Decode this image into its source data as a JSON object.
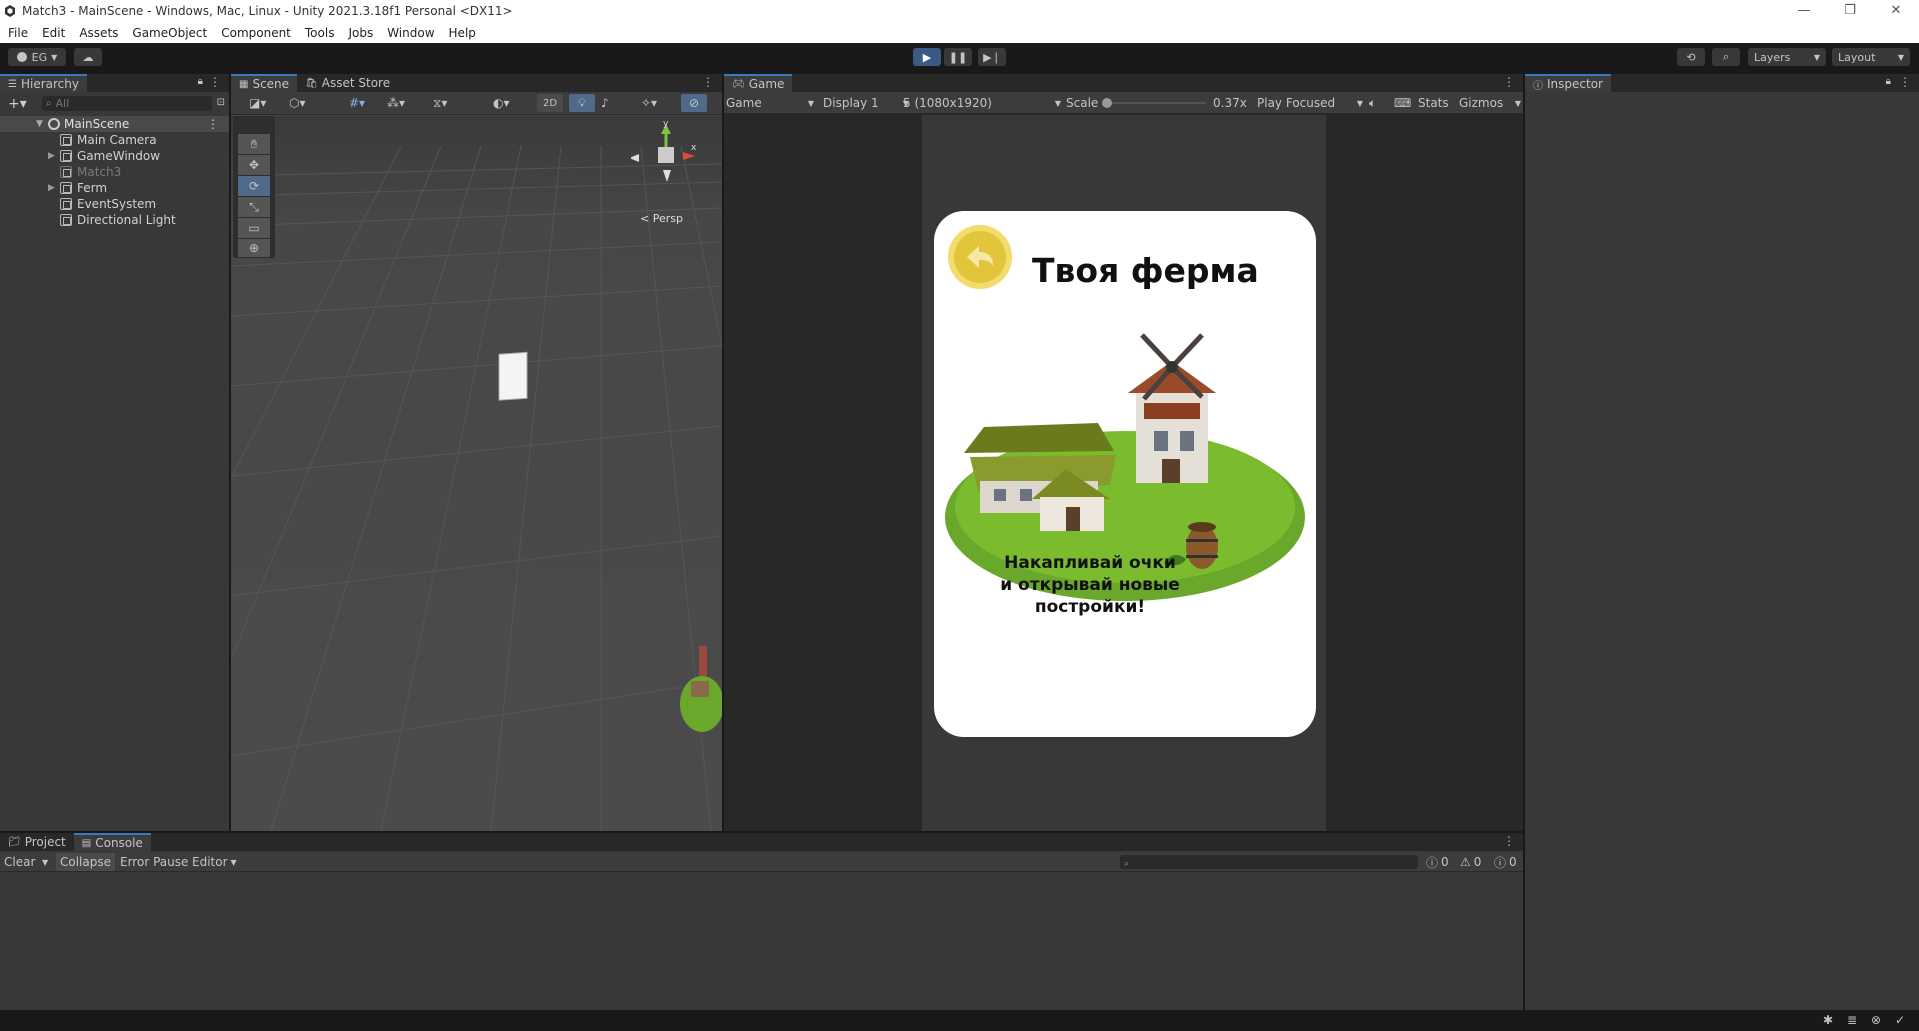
{
  "window": {
    "title": "Match3 - MainScene - Windows, Mac, Linux - Unity 2021.3.18f1 Personal <DX11>",
    "minimize": "—",
    "maximize": "❐",
    "close": "✕"
  },
  "menu": [
    "File",
    "Edit",
    "Assets",
    "GameObject",
    "Component",
    "Tools",
    "Jobs",
    "Window",
    "Help"
  ],
  "toolbar": {
    "account": "EG",
    "layers": "Layers",
    "layout": "Layout"
  },
  "hierarchy": {
    "tab": "Hierarchy",
    "search_placeholder": "All",
    "scene": "MainScene",
    "items": [
      {
        "label": "Main Camera",
        "expandable": false,
        "disabled": false
      },
      {
        "label": "GameWindow",
        "expandable": true,
        "disabled": false
      },
      {
        "label": "Match3",
        "expandable": false,
        "disabled": true
      },
      {
        "label": "Ferm",
        "expandable": true,
        "disabled": false
      },
      {
        "label": "EventSystem",
        "expandable": false,
        "disabled": false
      },
      {
        "label": "Directional Light",
        "expandable": false,
        "disabled": false
      }
    ]
  },
  "scene": {
    "tab": "Scene",
    "asset_store_tab": "Asset Store",
    "mode_2d": "2D",
    "persp": "< Persp",
    "gizmo_y": "y",
    "gizmo_x": "x"
  },
  "game": {
    "tab": "Game",
    "view": "Game",
    "display": "Display 1",
    "resolution": "5 (1080x1920)",
    "scale_label": "Scale",
    "scale_value": "0.37x",
    "play_mode": "Play Focused",
    "stats": "Stats",
    "gizmos": "Gizmos",
    "card": {
      "title": "Твоя ферма",
      "line1": "Накапливай очки",
      "line2": "и открывай новые",
      "line3": "постройки!"
    }
  },
  "inspector": {
    "tab": "Inspector"
  },
  "bottom": {
    "project_tab": "Project",
    "console_tab": "Console",
    "clear": "Clear",
    "collapse": "Collapse",
    "error_pause": "Error Pause",
    "editor": "Editor",
    "count_info": "0",
    "count_warn": "0",
    "count_error": "0"
  },
  "colors": {
    "accent": "#3a79bb",
    "panel": "#383838",
    "card_bg": "#ffffff",
    "grass": "#6aa82b",
    "coin": "#e8c84a"
  }
}
